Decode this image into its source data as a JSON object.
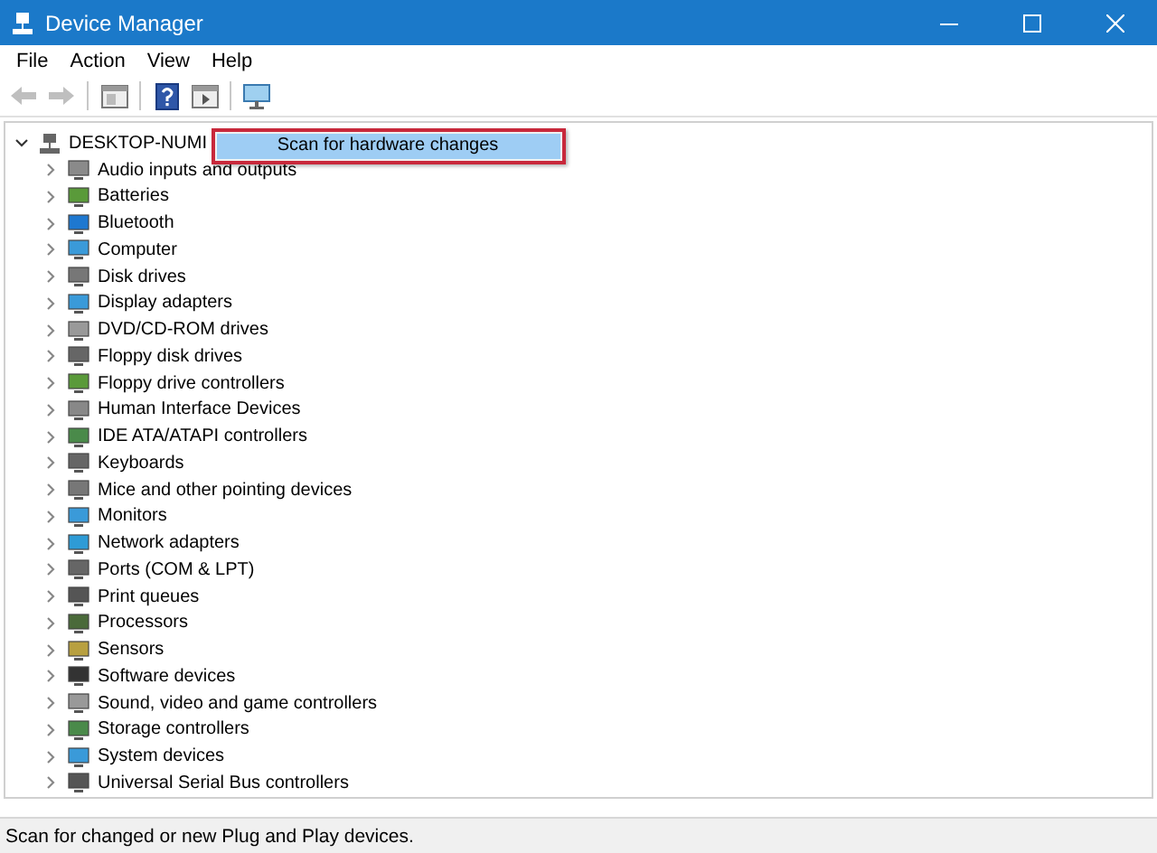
{
  "window": {
    "title": "Device Manager"
  },
  "menu": [
    "File",
    "Action",
    "View",
    "Help"
  ],
  "toolbar": [
    {
      "kind": "back",
      "disabled": true
    },
    {
      "kind": "forward",
      "disabled": true
    },
    {
      "kind": "separator"
    },
    {
      "kind": "properties",
      "disabled": false
    },
    {
      "kind": "separator"
    },
    {
      "kind": "help",
      "disabled": false
    },
    {
      "kind": "update",
      "disabled": false
    },
    {
      "kind": "separator"
    },
    {
      "kind": "scan",
      "disabled": false
    }
  ],
  "tree": {
    "label": "DESKTOP-NUMI",
    "expanded": true,
    "children": [
      {
        "label": "Audio inputs and outputs",
        "expanded": false
      },
      {
        "label": "Batteries",
        "expanded": false
      },
      {
        "label": "Bluetooth",
        "expanded": false
      },
      {
        "label": "Computer",
        "expanded": false
      },
      {
        "label": "Disk drives",
        "expanded": false
      },
      {
        "label": "Display adapters",
        "expanded": false
      },
      {
        "label": "DVD/CD-ROM drives",
        "expanded": false
      },
      {
        "label": "Floppy disk drives",
        "expanded": false
      },
      {
        "label": "Floppy drive controllers",
        "expanded": false
      },
      {
        "label": "Human Interface Devices",
        "expanded": false
      },
      {
        "label": "IDE ATA/ATAPI controllers",
        "expanded": false
      },
      {
        "label": "Keyboards",
        "expanded": false
      },
      {
        "label": "Mice and other pointing devices",
        "expanded": false
      },
      {
        "label": "Monitors",
        "expanded": false
      },
      {
        "label": "Network adapters",
        "expanded": false
      },
      {
        "label": "Ports (COM & LPT)",
        "expanded": false
      },
      {
        "label": "Print queues",
        "expanded": false
      },
      {
        "label": "Processors",
        "expanded": false
      },
      {
        "label": "Sensors",
        "expanded": false
      },
      {
        "label": "Software devices",
        "expanded": false
      },
      {
        "label": "Sound, video and game controllers",
        "expanded": false
      },
      {
        "label": "Storage controllers",
        "expanded": false
      },
      {
        "label": "System devices",
        "expanded": false
      },
      {
        "label": "Universal Serial Bus controllers",
        "expanded": false
      }
    ]
  },
  "context_menu": {
    "items": [
      {
        "label": "Scan for hardware changes",
        "selected": true
      }
    ]
  },
  "status_bar": "Scan for changed or new Plug and Play devices."
}
